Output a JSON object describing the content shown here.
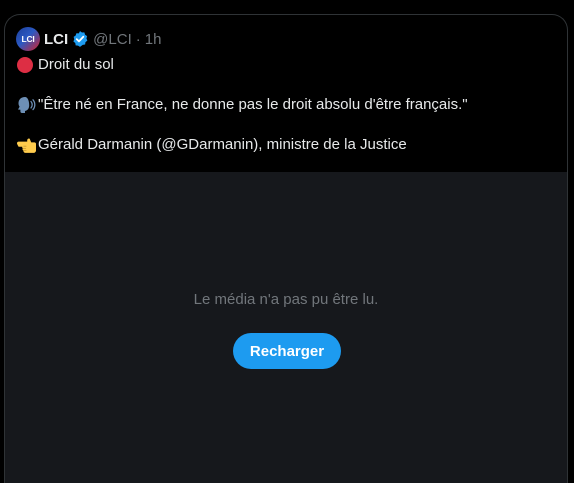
{
  "tweet": {
    "author": {
      "avatar_text": "LCI",
      "display_name": "LCI",
      "verified": true,
      "handle": "@LCI",
      "separator": "·",
      "time": "1h"
    },
    "lines": [
      {
        "icon": "red-circle-icon",
        "text": "Droit du sol"
      },
      {
        "icon": "speaking-head-icon",
        "text": "\"Être né en France, ne donne pas le droit absolu d'être français.\""
      },
      {
        "icon": "pointing-hand-icon",
        "text": "Gérald Darmanin (@GDarmanin), ministre de la Justice"
      }
    ]
  },
  "media": {
    "error_message": "Le média n'a pas pu être lu.",
    "reload_label": "Recharger"
  },
  "colors": {
    "background": "#000000",
    "media_background": "#16181c",
    "text": "#e7e9ea",
    "muted": "#71767b",
    "accent": "#1d9bf0",
    "border": "#2f3336"
  }
}
